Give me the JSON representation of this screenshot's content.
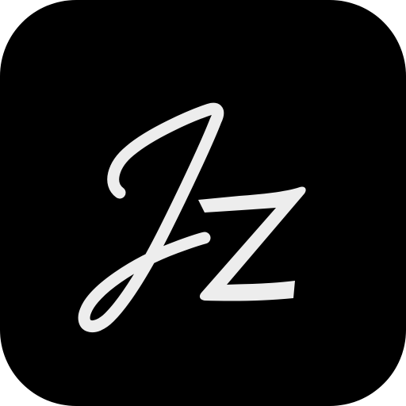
{
  "app_icon": {
    "name": "Jz",
    "logo_text": "Jz",
    "background_color": "#000000",
    "glyph_color": "#ededed"
  }
}
